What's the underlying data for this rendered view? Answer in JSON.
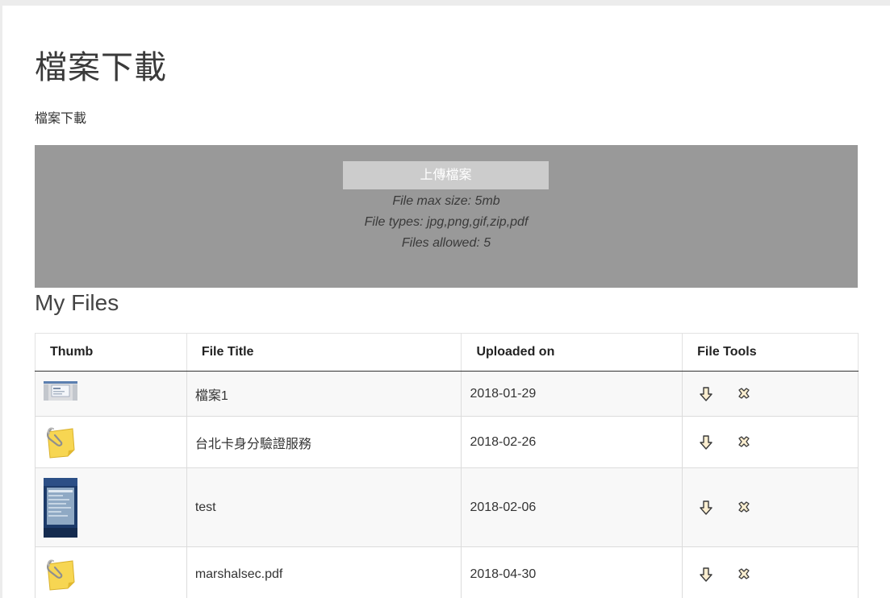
{
  "page": {
    "title": "檔案下載",
    "description": "檔案下載"
  },
  "upload": {
    "button_label": "上傳檔案",
    "info": [
      "File max size: 5mb",
      "File types: jpg,png,gif,zip,pdf",
      "Files allowed: 5"
    ]
  },
  "files_section": {
    "title": "My Files",
    "columns": [
      "Thumb",
      "File Title",
      "Uploaded on",
      "File Tools"
    ],
    "rows": [
      {
        "thumb": "screenshot-thumbnail",
        "title": "檔案1",
        "uploaded": "2018-01-29",
        "tools": [
          "download-icon",
          "delete-icon"
        ]
      },
      {
        "thumb": "paperclip-note-icon",
        "title": "台北卡身分驗證服務",
        "uploaded": "2018-02-26",
        "tools": [
          "download-icon",
          "delete-icon"
        ]
      },
      {
        "thumb": "photo-thumbnail",
        "title": "test",
        "uploaded": "2018-02-06",
        "tools": [
          "download-icon",
          "delete-icon"
        ]
      },
      {
        "thumb": "paperclip-note-icon",
        "title": "marshalsec.pdf",
        "uploaded": "2018-04-30",
        "tools": [
          "download-icon",
          "delete-icon"
        ]
      }
    ]
  }
}
